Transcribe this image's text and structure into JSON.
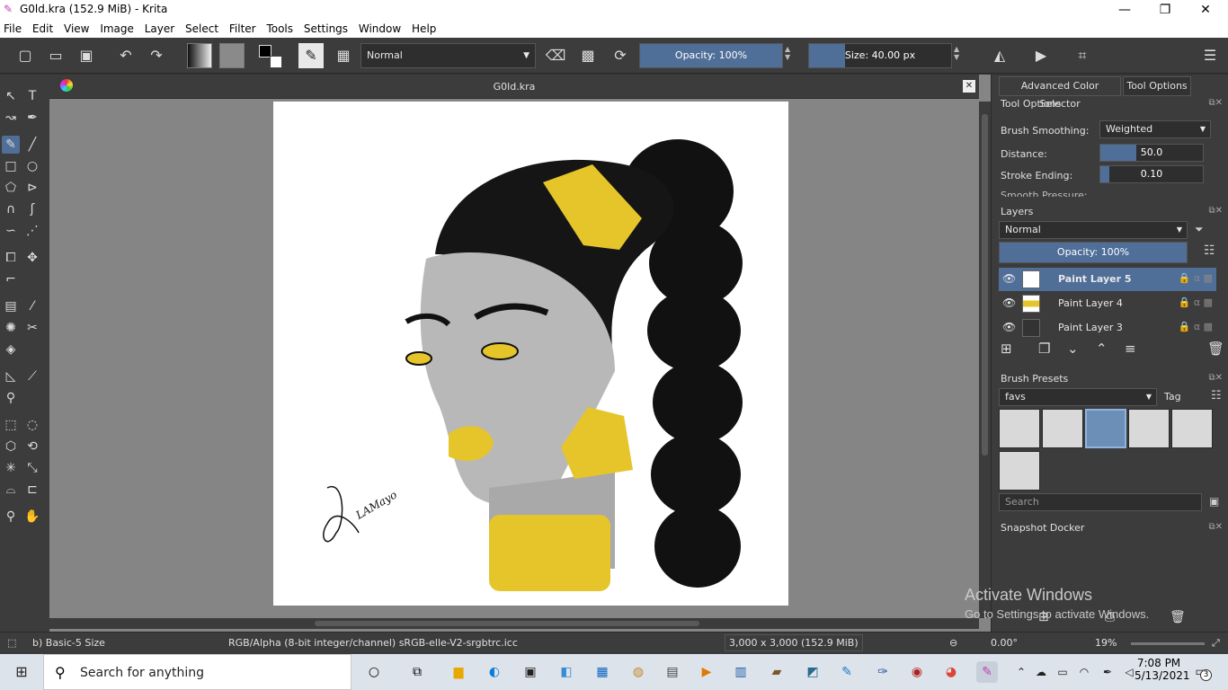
{
  "app": {
    "window_title": "G0ld.kra (152.9 MiB)  - Krita",
    "doc_tab_title": "G0ld.kra"
  },
  "menu": [
    "File",
    "Edit",
    "View",
    "Image",
    "Layer",
    "Select",
    "Filter",
    "Tools",
    "Settings",
    "Window",
    "Help"
  ],
  "toolbar": {
    "blend_mode": "Normal",
    "opacity_label": "Opacity: 100%",
    "opacity_value": 1.0,
    "size_label": "Size: 40.00 px",
    "size_value": 40.0
  },
  "tool_options": {
    "tabs": [
      "Advanced Color Selector",
      "Tool Options"
    ],
    "active_tab": "Tool Options",
    "title": "Tool Options",
    "brush_smoothing_label": "Brush Smoothing:",
    "brush_smoothing_value": "Weighted",
    "distance_label": "Distance:",
    "distance_value": "50.0",
    "stroke_ending_label": "Stroke Ending:",
    "stroke_ending_value": "0.10",
    "smooth_pressure_label": "Smooth Pressure:"
  },
  "layers": {
    "title": "Layers",
    "blend_mode": "Normal",
    "opacity_label": "Opacity:  100%",
    "items": [
      {
        "name": "Paint Layer 5",
        "selected": true
      },
      {
        "name": "Paint Layer 4",
        "selected": false
      },
      {
        "name": "Paint Layer 3",
        "selected": false
      }
    ]
  },
  "brush_presets": {
    "title": "Brush Presets",
    "tag_filter": "favs",
    "tag_label": "Tag",
    "search_placeholder": "Search"
  },
  "snapshot": {
    "title": "Snapshot Docker"
  },
  "canvas": {
    "signature_text": "LAMayo"
  },
  "statusbar": {
    "brush_name": "b) Basic-5 Size",
    "color_profile": "RGB/Alpha (8-bit integer/channel)  sRGB-elle-V2-srgbtrc.icc",
    "image_size": "3,000 x 3,000 (152.9 MiB)",
    "rotation": "0.00°",
    "zoom": "19%"
  },
  "watermark": {
    "line1": "Activate Windows",
    "line2": "Go to Settings to activate Windows."
  },
  "taskbar": {
    "search_placeholder": "Search for anything",
    "time": "7:08 PM",
    "date": "5/13/2021",
    "notification_count": "3"
  },
  "colors": {
    "accent": "#4f6e98",
    "panel": "#3c3c3c",
    "canvas_bg": "#858585",
    "yellow_paint": "#e5c52a"
  }
}
